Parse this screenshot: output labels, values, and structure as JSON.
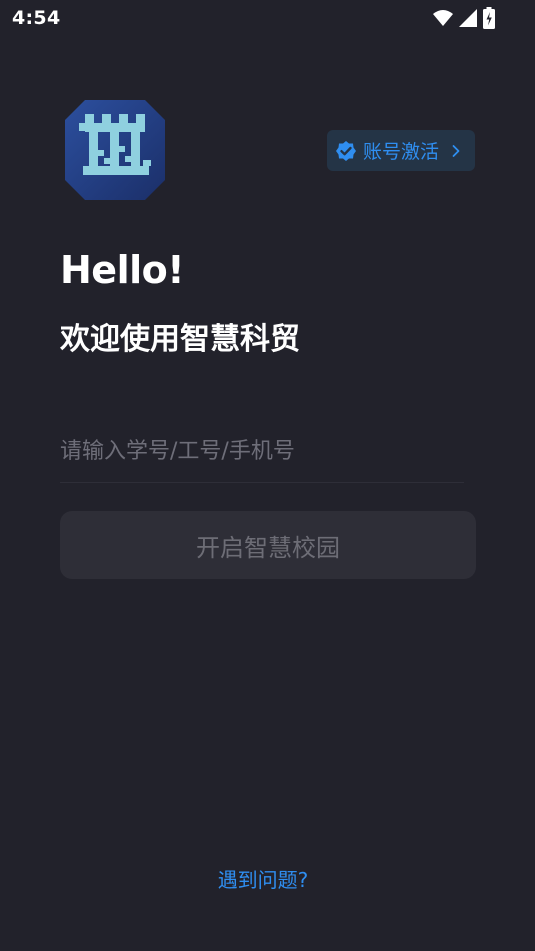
{
  "status_bar": {
    "time": "4:54",
    "icons": [
      "wifi-icon",
      "signal-icon",
      "battery-charging-icon"
    ]
  },
  "app": {
    "logo_icon": "campus-tower-logo",
    "colors": {
      "background": "#22222b",
      "accent": "#2f8ef0",
      "button_disabled_bg": "#2e2e37",
      "button_disabled_text": "#6d6d76",
      "placeholder": "#6e6e79"
    }
  },
  "activation": {
    "label": "账号激活",
    "icon": "verified-badge-icon",
    "chevron": "chevron-right-icon"
  },
  "greeting": {
    "title": "Hello!",
    "subtitle": "欢迎使用智慧科贸"
  },
  "login": {
    "input_placeholder": "请输入学号/工号/手机号",
    "input_value": "",
    "submit_label": "开启智慧校园"
  },
  "footer": {
    "help_label": "遇到问题?"
  }
}
